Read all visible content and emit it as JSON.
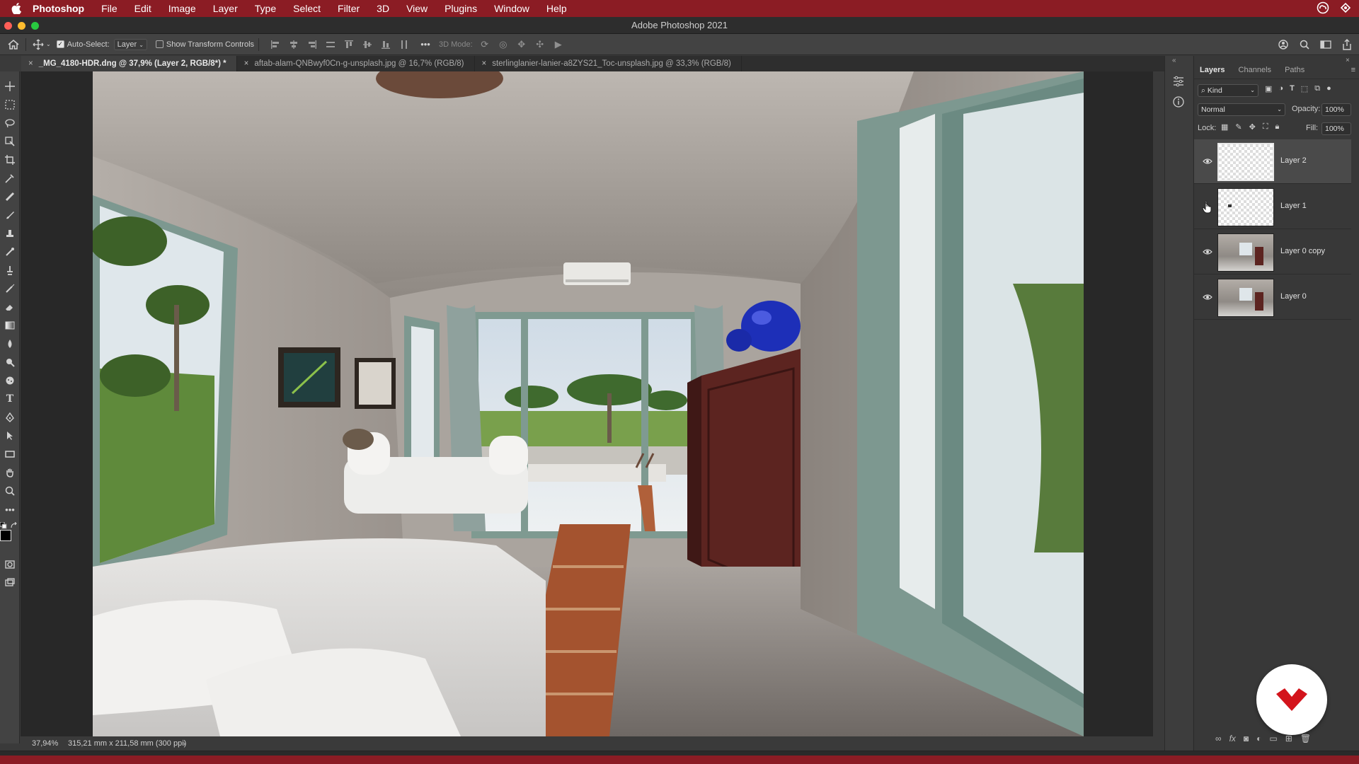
{
  "menubar": {
    "app_name": "Photoshop",
    "items": [
      "File",
      "Edit",
      "Image",
      "Layer",
      "Type",
      "Select",
      "Filter",
      "3D",
      "View",
      "Plugins",
      "Window",
      "Help"
    ]
  },
  "window": {
    "title": "Adobe Photoshop 2021"
  },
  "options": {
    "auto_select_label": "Auto-Select:",
    "auto_select_value": "Layer",
    "transform_controls_label": "Show Transform Controls",
    "mode_3d_label": "3D Mode:"
  },
  "tabs": [
    {
      "label": "_MG_4180-HDR.dng @ 37,9% (Layer 2, RGB/8*) *",
      "active": true
    },
    {
      "label": "aftab-alam-QNBwyf0Cn-g-unsplash.jpg @ 16,7% (RGB/8)",
      "active": false
    },
    {
      "label": "sterlinglanier-lanier-a8ZYS21_Toc-unsplash.jpg @ 33,3% (RGB/8)",
      "active": false
    }
  ],
  "status": {
    "zoom": "37,94%",
    "doc_size": "315,21 mm x 211,58 mm (300 ppi)"
  },
  "layers_panel": {
    "tabs": [
      "Layers",
      "Channels",
      "Paths"
    ],
    "filter_kind": "Kind",
    "blend_mode": "Normal",
    "opacity_label": "Opacity:",
    "opacity_value": "100%",
    "lock_label": "Lock:",
    "fill_label": "Fill:",
    "fill_value": "100%",
    "layers": [
      {
        "name": "Layer 2",
        "visible": true,
        "selected": true
      },
      {
        "name": "Layer 1",
        "visible": false,
        "selected": false
      },
      {
        "name": "Layer 0 copy",
        "visible": true,
        "selected": false
      },
      {
        "name": "Layer 0",
        "visible": true,
        "selected": false
      }
    ]
  },
  "colors": {
    "accent_red": "#8b1c24",
    "panel_bg": "#383838",
    "canvas_bg": "#282828"
  }
}
